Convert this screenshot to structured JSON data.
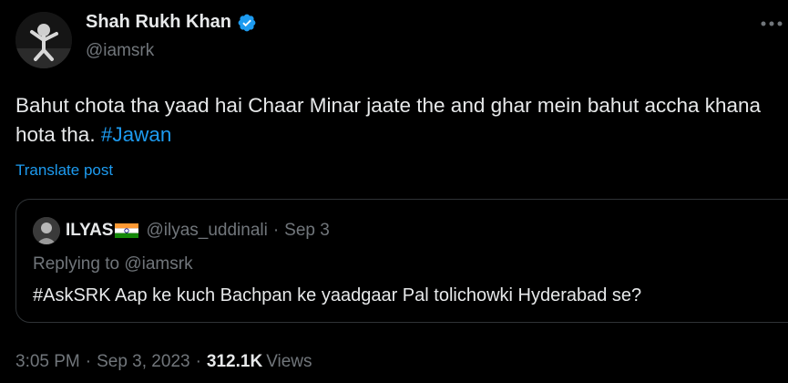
{
  "author": {
    "name": "Shah Rukh Khan",
    "handle": "@iamsrk",
    "verified_color": "#1d9bf0"
  },
  "tweet": {
    "text": "Bahut chota tha yaad hai Chaar Minar jaate the and ghar mein bahut accha khana hota tha. ",
    "hashtag": "#Jawan",
    "translate_label": "Translate post"
  },
  "quote": {
    "name": "ILYAS",
    "flag": "india-flag-icon",
    "handle": "@ilyas_uddinali",
    "separator": "·",
    "date": "Sep 3",
    "replying_to": "Replying to @iamsrk",
    "text": "#AskSRK Aap ke kuch Bachpan ke yaadgaar Pal tolichowki Hyderabad se?"
  },
  "meta": {
    "time": "3:05 PM",
    "separator": "·",
    "date": "Sep 3, 2023",
    "views_count": "312.1K",
    "views_label": "Views"
  },
  "colors": {
    "background": "#000000",
    "text_primary": "#e7e9ea",
    "text_secondary": "#71767b",
    "accent": "#1d9bf0",
    "border": "#2f3336"
  }
}
